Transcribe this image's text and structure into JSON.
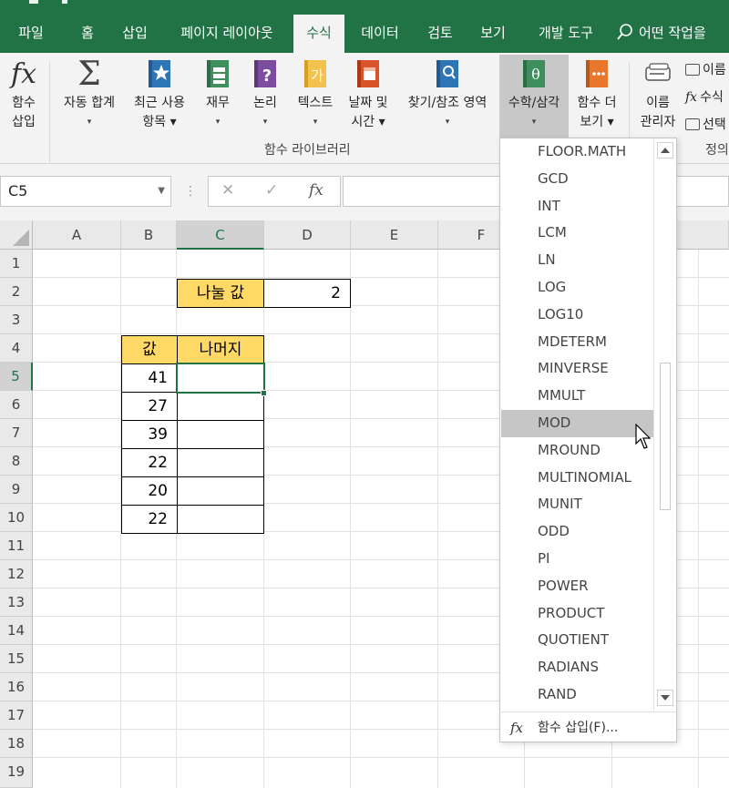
{
  "ribbon_tabs": [
    {
      "label": "파일",
      "active": false
    },
    {
      "label": "홈",
      "active": false
    },
    {
      "label": "삽입",
      "active": false
    },
    {
      "label": "페이지 레이아웃",
      "active": false
    },
    {
      "label": "수식",
      "active": true
    },
    {
      "label": "데이터",
      "active": false
    },
    {
      "label": "검토",
      "active": false
    },
    {
      "label": "보기",
      "active": false
    },
    {
      "label": "개발 도구",
      "active": false
    }
  ],
  "tell_me": {
    "label": "어떤 작업을",
    "icon": "lightbulb-search-icon"
  },
  "ribbon_buttons": [
    {
      "id": "insert-function",
      "line1": "함수",
      "line2": "삽입",
      "icon": "fx-icon"
    },
    {
      "id": "autosum",
      "line1": "자동 합계",
      "line2": "▾",
      "icon": "sigma-icon"
    },
    {
      "id": "recently-used",
      "line1": "최근 사용",
      "line2": "항목 ▾",
      "icon": "star-book-icon"
    },
    {
      "id": "financial",
      "line1": "재무",
      "line2": "▾",
      "icon": "money-book-icon"
    },
    {
      "id": "logical",
      "line1": "논리",
      "line2": "▾",
      "icon": "question-book-icon"
    },
    {
      "id": "text",
      "line1": "텍스트",
      "line2": "▾",
      "icon": "text-book-icon"
    },
    {
      "id": "date-time",
      "line1": "날짜 및",
      "line2": "시간 ▾",
      "icon": "calendar-book-icon"
    },
    {
      "id": "lookup-ref",
      "line1": "찾기/참조 영역",
      "line2": "▾",
      "icon": "search-book-icon"
    },
    {
      "id": "math-trig",
      "line1": "수학/삼각",
      "line2": "▾",
      "icon": "theta-book-icon"
    },
    {
      "id": "more-functions",
      "line1": "함수 더",
      "line2": "보기 ▾",
      "icon": "dots-book-icon"
    },
    {
      "id": "name-manager",
      "line1": "이름",
      "line2": "관리자",
      "icon": "name-tag-icon"
    }
  ],
  "ribbon_group_label": "함수 라이브러리",
  "ribbon_group_label_right": "정의",
  "ribbon_mini_items": [
    "이름",
    "수식",
    "선택"
  ],
  "formula_bar": {
    "name_box": "C5",
    "cancel": "✕",
    "enter": "✓",
    "fx": "fx",
    "formula": ""
  },
  "columns": [
    "A",
    "B",
    "C",
    "D",
    "E",
    "F"
  ],
  "rows": [
    "1",
    "2",
    "3",
    "4",
    "5",
    "6",
    "7",
    "8",
    "9",
    "10",
    "11",
    "12",
    "13",
    "14",
    "15",
    "16",
    "17",
    "18",
    "19"
  ],
  "cells": {
    "divisor_label": "나눌 값",
    "divisor_value": "2",
    "header_value": "값",
    "header_remainder": "나머지",
    "values": [
      "41",
      "27",
      "39",
      "22",
      "20",
      "22"
    ]
  },
  "dropdown": {
    "items": [
      "FLOOR.MATH",
      "GCD",
      "INT",
      "LCM",
      "LN",
      "LOG",
      "LOG10",
      "MDETERM",
      "MINVERSE",
      "MMULT",
      "MOD",
      "MROUND",
      "MULTINOMIAL",
      "MUNIT",
      "ODD",
      "PI",
      "POWER",
      "PRODUCT",
      "QUOTIENT",
      "RADIANS",
      "RAND"
    ],
    "highlighted": "MOD",
    "footer": "함수 삽입(F)..."
  },
  "colors": {
    "accent": "#217346",
    "header_fill": "#ffd966",
    "highlight": "#c6c6c6"
  }
}
